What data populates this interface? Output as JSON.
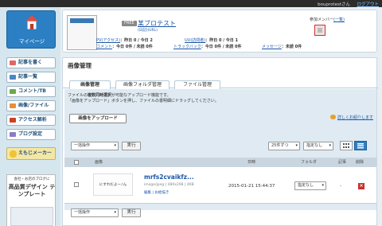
{
  "topbar": {
    "user": "bouprotestさん",
    "logout": "ログアウト"
  },
  "sidebar": {
    "mypage": "マイページ",
    "items": [
      {
        "label": "記事を書く",
        "color": "#e06666"
      },
      {
        "label": "記事一覧",
        "color": "#4a86c5"
      },
      {
        "label": "コメント/TB",
        "color": "#6aa84f"
      },
      {
        "label": "画像/ファイル",
        "color": "#e69138"
      },
      {
        "label": "アクセス解析",
        "color": "#cc4125"
      },
      {
        "label": "ブログ設定",
        "color": "#8e7cc3"
      }
    ],
    "emoji": "えもじメーカー",
    "ad": {
      "line1": "会社・お店のブログに",
      "line2": "高品質デザイン テンプレート"
    }
  },
  "profile": {
    "badge": "FREE",
    "title": "某ブロテスト",
    "links": "(日記)(URL)",
    "pv": {
      "label": "PV(アクセス)",
      "value": "：昨日 0 / 今日 2"
    },
    "uu": {
      "label": "UU(訪問者)",
      "value": "：昨日 0 / 今日 1"
    },
    "comment": {
      "label": "コメント",
      "value": "：今日 0件 / 未読 0件"
    },
    "trackback": {
      "label": "トラックバック",
      "value": "：今日 0件 / 未読 0件"
    },
    "message": {
      "label": "メッセージ",
      "value": "：未読 0件"
    },
    "members_label": "参加メンバー",
    "members_link": "(一覧)"
  },
  "main": {
    "title": "画像管理",
    "tabs": [
      "画像管理",
      "画像フォルダ管理",
      "ファイル管理"
    ],
    "info_line1_pre": "ファイルの",
    "info_line1_bold": "複数同時選択",
    "info_line1_post": "が可能なアップロード機能です。",
    "info_line2": "「画像をアップロード」ボタンを押し、ファイルの書明細にドラッグしてください。",
    "upload_button": "画像をアップロード",
    "help_link": "詳しくお紹介します",
    "bulk_select": "一括操作",
    "exec_button": "実行",
    "per_page": "25件ずつ",
    "folder_filter": "指定なし",
    "columns": {
      "image": "画像",
      "date": "日時",
      "folder": "フォルダ",
      "article": "記事",
      "delete": "削除"
    },
    "row": {
      "thumb_text": "にすれだよー♪ん",
      "filename": "mrfs2cvaikfz...",
      "meta": "image/jpeg | 480x298 | 4KB",
      "actions": "編集 | お絵描き",
      "date": "2015-01-21 15:44:37",
      "folder": "指定なし",
      "article": "-"
    }
  }
}
